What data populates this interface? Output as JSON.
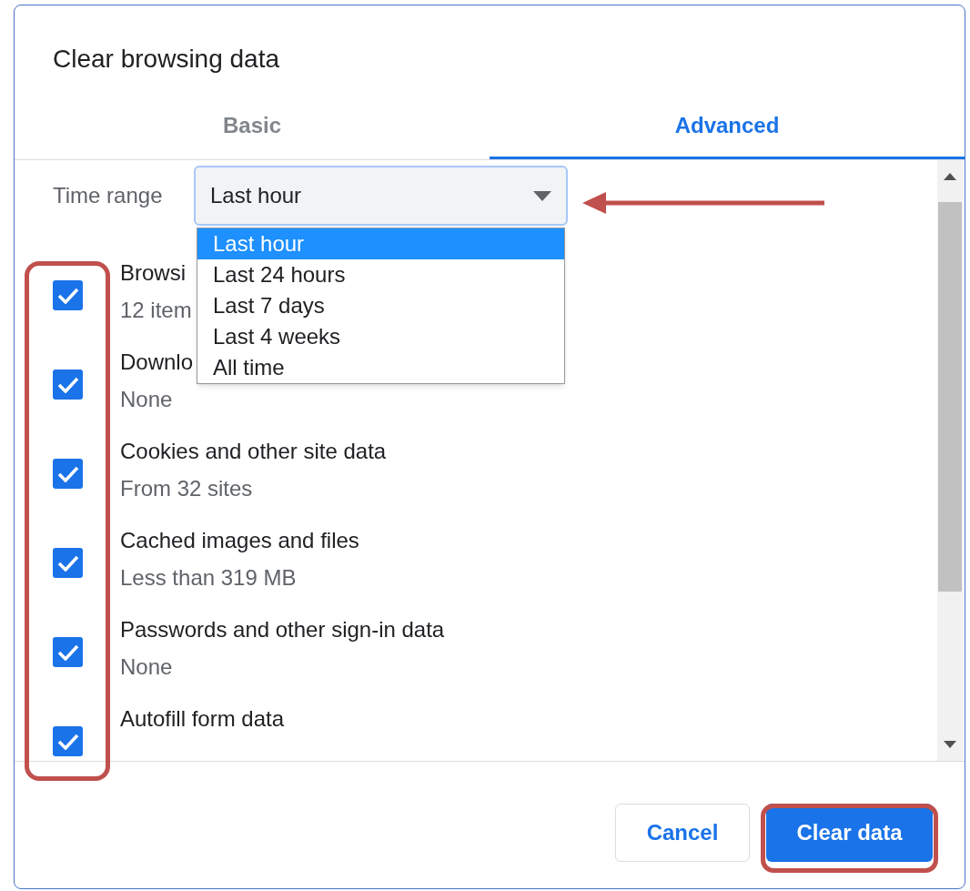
{
  "dialog": {
    "title": "Clear browsing data"
  },
  "tabs": [
    {
      "label": "Basic",
      "selected": false
    },
    {
      "label": "Advanced",
      "selected": true
    }
  ],
  "time_range": {
    "label": "Time range",
    "value": "Last hour",
    "expanded": true,
    "options": [
      {
        "label": "Last hour",
        "selected": true
      },
      {
        "label": "Last 24 hours",
        "selected": false
      },
      {
        "label": "Last 7 days",
        "selected": false
      },
      {
        "label": "Last 4 weeks",
        "selected": false
      },
      {
        "label": "All time",
        "selected": false
      }
    ]
  },
  "items": [
    {
      "title": "Browsi",
      "detail": "12 item",
      "checked": true
    },
    {
      "title": "Downlo",
      "detail": "None",
      "checked": true
    },
    {
      "title": "Cookies and other site data",
      "detail": "From 32 sites",
      "checked": true
    },
    {
      "title": "Cached images and files",
      "detail": "Less than 319 MB",
      "checked": true
    },
    {
      "title": "Passwords and other sign-in data",
      "detail": "None",
      "checked": true
    },
    {
      "title": "Autofill form data",
      "checked": true
    }
  ],
  "buttons": [
    {
      "label": "Cancel",
      "kind": "secondary"
    },
    {
      "label": "Clear data",
      "kind": "primary"
    }
  ]
}
